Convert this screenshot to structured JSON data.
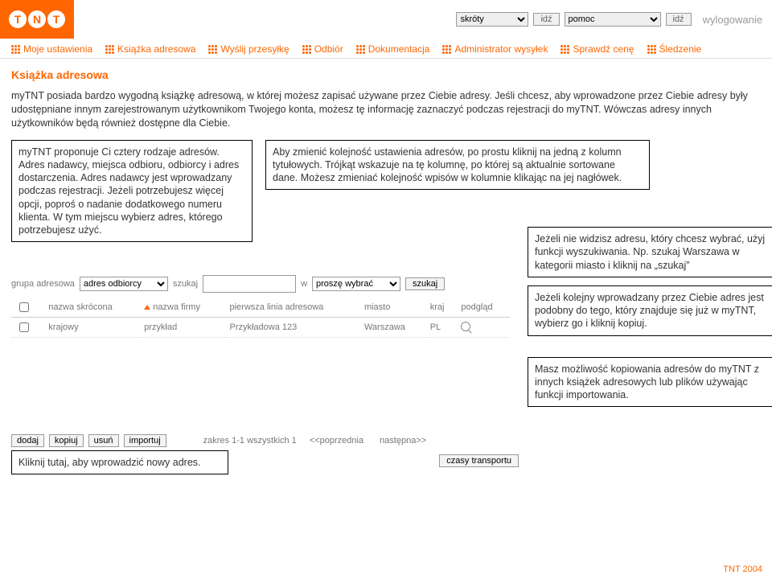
{
  "topbar": {
    "logo_letters": [
      "T",
      "N",
      "T"
    ],
    "shortcuts_label": "skróty",
    "help_label": "pomoc",
    "go_label": "idź",
    "logout_label": "wylogowanie"
  },
  "nav": {
    "items": [
      "Moje ustawienia",
      "Książka adresowa",
      "Wyślij przesyłkę",
      "Odbiór",
      "Dokumentacja",
      "Administrator wysyłek",
      "Sprawdź cenę",
      "Śledzenie"
    ]
  },
  "page": {
    "title": "Książka adresowa",
    "intro": "myTNT posiada bardzo wygodną książkę adresową, w której możesz zapisać używane przez Ciebie adresy. Jeśli chcesz, aby wprowadzone przez Ciebie adresy były udostępniane innym zarejestrowanym użytkownikom Twojego konta, możesz tę informację zaznaczyć podczas rejestracji do myTNT. Wówczas adresy innych użytkowników będą również dostępne dla Ciebie."
  },
  "notes": {
    "left1": "myTNT proponuje Ci cztery rodzaje adresów. Adres nadawcy, miejsca odbioru, odbiorcy i adres dostarczenia. Adres nadawcy jest wprowadzany podczas rejestracji.  Jeżeli potrzebujesz  więcej opcji,  poproś o nadanie dodatkowego numeru klienta. W tym miejscu wybierz adres, którego potrzebujesz użyć.",
    "right1": "Aby zmienić kolejność ustawienia  adresów, po prostu kliknij na jedną z kolumn tytułowych. Trójkąt wskazuje na tę kolumnę, po której są aktualnie sortowane dane. Możesz zmieniać kolejność wpisów w kolumnie klikając na jej nagłówek.",
    "right2": "Jeżeli nie widzisz adresu, który chcesz wybrać, użyj funkcji wyszukiwania. Np. szukaj Warszawa w kategorii miasto i kliknij na „szukaj”",
    "right3": "Jeżeli kolejny wprowadzany przez Ciebie adres jest podobny do tego, który  znajduje się już w myTNT, wybierz go i kliknij kopiuj.",
    "right4": "Masz możliwość kopiowania adresów do myTNT z innych książek adresowych lub plików używając funkcji importowania.",
    "left2": "Kliknij tutaj, aby wprowadzić nowy adres."
  },
  "filter": {
    "group_label": "grupa adresowa",
    "group_value": "adres odbiorcy",
    "search_label": "szukaj",
    "in_label": "w",
    "in_value": "proszę wybrać",
    "search_btn": "szukaj"
  },
  "table": {
    "headers": [
      "nazwa skrócona",
      "nazwa firmy",
      "pierwsza linia adresowa",
      "miasto",
      "kraj",
      "podgląd"
    ],
    "row": {
      "short": "krajowy",
      "firm": "przykład",
      "addr": "Przykładowa 123",
      "city": "Warszawa",
      "country": "PL"
    }
  },
  "actions": {
    "add": "dodaj",
    "copy": "kopiuj",
    "del": "usuń",
    "import": "importuj",
    "range": "zakres 1-1 wszystkich 1",
    "prev": "<<poprzednia",
    "next": "następna>>",
    "times": "czasy transportu"
  },
  "footer": "TNT 2004"
}
